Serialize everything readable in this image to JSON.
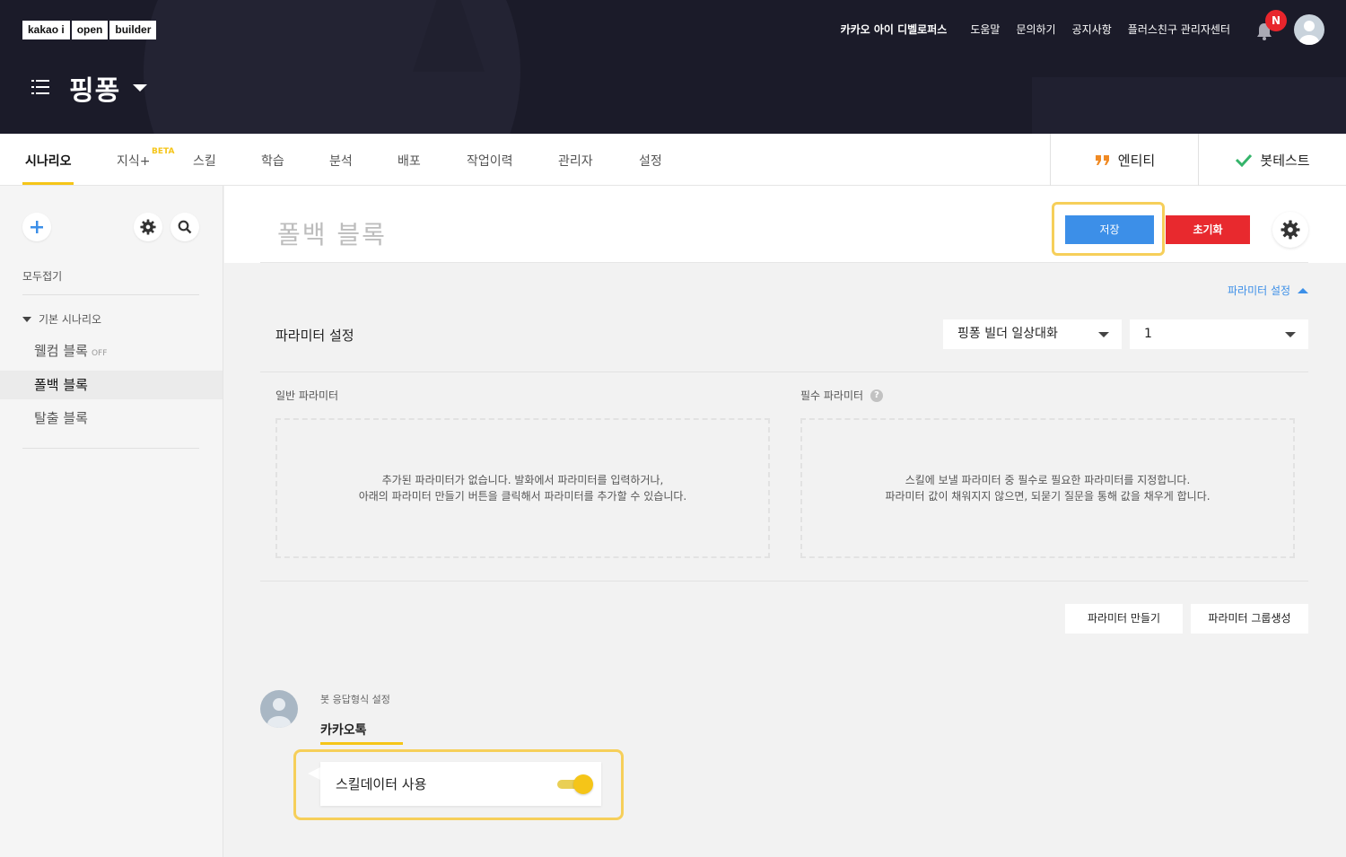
{
  "header": {
    "logo_parts": [
      "kakao i",
      "open",
      "builder"
    ],
    "bot_name": "핑퐁",
    "nav": [
      "카카오 아이 디벨로퍼스",
      "도움말",
      "문의하기",
      "공지사항",
      "플러스친구 관리자센터"
    ],
    "notification_badge": "N"
  },
  "tabs": {
    "items": [
      "시나리오",
      "지식+",
      "스킬",
      "학습",
      "분석",
      "배포",
      "작업이력",
      "관리자",
      "설정"
    ],
    "beta_label": "BETA",
    "entity_label": "엔티티",
    "bottest_label": "봇테스트"
  },
  "sidebar": {
    "collapse_all": "모두접기",
    "group_title": "기본 시나리오",
    "items": [
      {
        "label": "웰컴 블록",
        "status": "OFF"
      },
      {
        "label": "폴백 블록"
      },
      {
        "label": "탈출 블록"
      }
    ]
  },
  "main": {
    "block_title": "폴백 블록",
    "save_label": "저장",
    "reset_label": "초기화",
    "param_toggle_label": "파라미터 설정",
    "param_title": "파라미터 설정",
    "select_scenario": "핑퐁 빌더 일상대화",
    "select_number": "1",
    "general_param_label": "일반 파라미터",
    "required_param_label": "필수 파라미터",
    "help_glyph": "?",
    "general_empty": [
      "추가된 파라미터가 없습니다. 발화에서 파라미터를 입력하거나,",
      "아래의 파라미터 만들기 버튼을 클릭해서 파라미터를 추가할 수 있습니다."
    ],
    "required_empty": [
      "스킬에 보낼 파라미터 중 필수로 필요한 파라미터를 지정합니다.",
      "파라미터 값이 채워지지 않으면, 되묻기 질문을 통해 값을 채우게 합니다."
    ],
    "make_param_label": "파라미터 만들기",
    "group_param_label": "파라미터 그룹생성"
  },
  "response": {
    "label": "봇 응답형식 설정",
    "tab": "카카오톡",
    "skill_data_label": "스킬데이터 사용",
    "skill_data_enabled": true
  },
  "colors": {
    "accent_yellow": "#f5c518",
    "save_blue": "#3c8fe8",
    "reset_red": "#e8292e",
    "header_bg": "#1b1b29"
  }
}
